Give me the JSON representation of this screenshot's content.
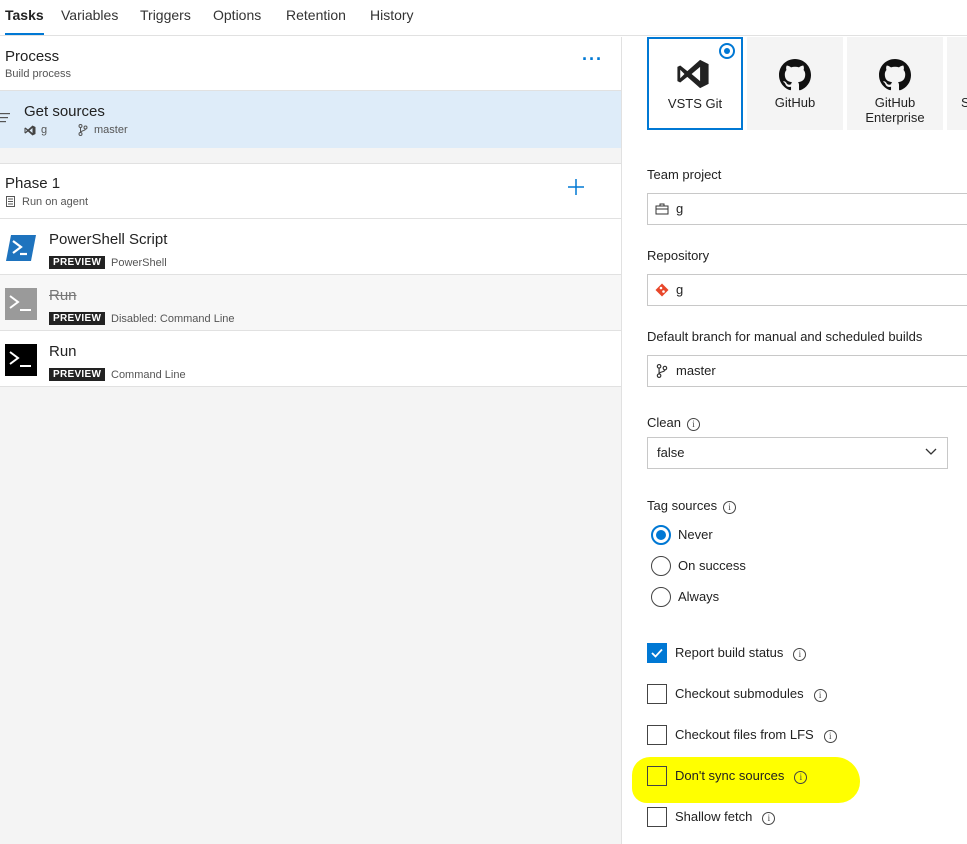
{
  "tabs": [
    "Tasks",
    "Variables",
    "Triggers",
    "Options",
    "Retention",
    "History"
  ],
  "process": {
    "title": "Process",
    "subtitle": "Build process"
  },
  "get_sources": {
    "title": "Get sources",
    "repo": "g",
    "branch": "master"
  },
  "phase": {
    "title": "Phase 1",
    "subtitle": "Run on agent"
  },
  "tasks": [
    {
      "title": "PowerShell Script",
      "badge": "PREVIEW",
      "subtitle": "PowerShell"
    },
    {
      "title": "Run",
      "badge": "PREVIEW",
      "subtitle": "Disabled: Command Line"
    },
    {
      "title": "Run",
      "badge": "PREVIEW",
      "subtitle": "Command Line"
    }
  ],
  "repo_types": [
    {
      "label": "VSTS Git",
      "selected": true
    },
    {
      "label": "GitHub"
    },
    {
      "label": "GitHub Enterprise"
    },
    {
      "label": "S"
    }
  ],
  "team_project": {
    "label": "Team project",
    "value": "g"
  },
  "repository": {
    "label": "Repository",
    "value": "g"
  },
  "default_branch": {
    "label": "Default branch for manual and scheduled builds",
    "value": "master"
  },
  "clean": {
    "label": "Clean",
    "value": "false"
  },
  "tag_sources": {
    "label": "Tag sources",
    "options": [
      "Never",
      "On success",
      "Always"
    ],
    "selected": "Never"
  },
  "checkboxes": [
    {
      "label": "Report build status",
      "checked": true
    },
    {
      "label": "Checkout submodules",
      "checked": false
    },
    {
      "label": "Checkout files from LFS",
      "checked": false
    },
    {
      "label": "Don't sync sources",
      "checked": false
    },
    {
      "label": "Shallow fetch",
      "checked": false
    }
  ],
  "info_glyph": "i",
  "colors": {
    "accent": "#0078d4",
    "selected_row": "#deecf9",
    "highlight": "#ffff00"
  }
}
